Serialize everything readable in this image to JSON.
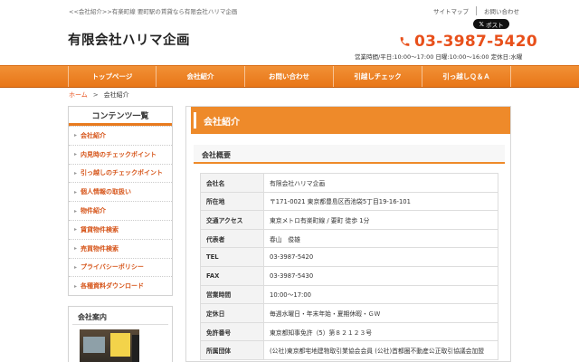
{
  "header": {
    "tagline_link": "<<会社紹介",
    "tagline_text": ">>有楽町線 要町駅の賃貸なら有限会社ハリマ企画",
    "sitemap": "サイトマップ",
    "contact": "お問い合わせ",
    "post_button": "ポスト",
    "company_name": "有限会社ハリマ企画",
    "phone": "03-3987-5420",
    "hours": "営業時間/平日:10:00～17:00 日曜:10:00～16:00 定休日:水曜"
  },
  "nav": {
    "items": [
      "トップページ",
      "会社紹介",
      "お問い合わせ",
      "引越しチェック",
      "引っ越しＱ＆Ａ"
    ]
  },
  "breadcrumb": {
    "home": "ホーム",
    "separator": ">",
    "current": "会社紹介"
  },
  "sidebar": {
    "heading": "コンテンツ一覧",
    "items": [
      "会社紹介",
      "内見時のチェックポイント",
      "引っ越しのチェックポイント",
      "個人情報の取扱い",
      "物件紹介",
      "賃貸物件検索",
      "売買物件検索",
      "プライバシーポリシー",
      "各種資料ダウンロード"
    ],
    "company_box_title": "会社案内"
  },
  "main": {
    "heading": "会社紹介",
    "section_title": "会社概要",
    "rows": [
      {
        "label": "会社名",
        "value": "有限会社ハリマ企画"
      },
      {
        "label": "所在地",
        "value": "〒171-0021 東京都豊島区西池袋5丁目19-16-101"
      },
      {
        "label": "交通アクセス",
        "value": "東京メトロ有楽町線 / 要町 徒歩 1分"
      },
      {
        "label": "代表者",
        "value": "春山　俊雄"
      },
      {
        "label": "TEL",
        "value": "03-3987-5420"
      },
      {
        "label": "FAX",
        "value": "03-3987-5430"
      },
      {
        "label": "営業時間",
        "value": "10:00～17:00"
      },
      {
        "label": "定休日",
        "value": "毎週水曜日・年末年始・夏期休暇・ＧＷ"
      },
      {
        "label": "免許番号",
        "value": "東京都知事免許（5）第８２１２３号"
      },
      {
        "label": "所属団体",
        "value": "(公社)東京都宅地建物取引業協会会員 (公社)首都圏不動産公正取引協議会加盟"
      }
    ]
  },
  "colors": {
    "accent": "#ee8a2a",
    "phone": "#e8501b",
    "link": "#d6551a"
  }
}
